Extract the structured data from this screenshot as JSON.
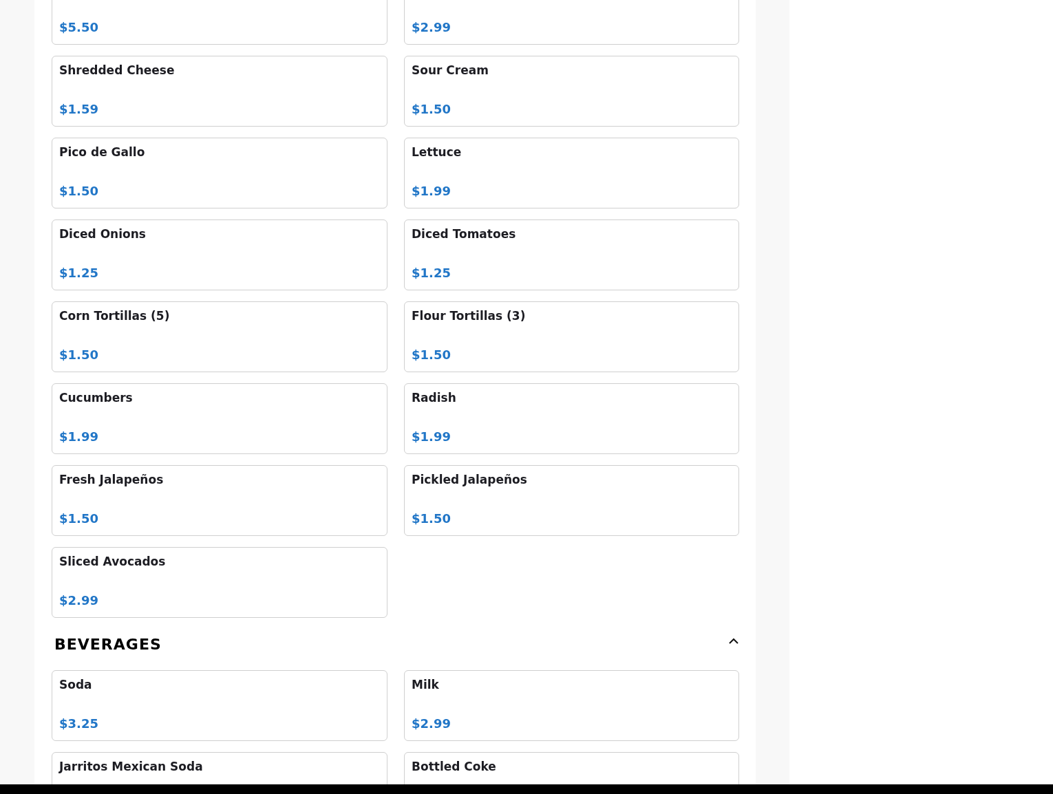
{
  "sections": [
    {
      "items": [
        {
          "price": "$5.50"
        },
        {
          "price": "$2.99"
        },
        {
          "name": "Shredded Cheese",
          "price": "$1.59"
        },
        {
          "name": "Sour Cream",
          "price": "$1.50"
        },
        {
          "name": "Pico de Gallo",
          "price": "$1.50"
        },
        {
          "name": "Lettuce",
          "price": "$1.99"
        },
        {
          "name": "Diced Onions",
          "price": "$1.25"
        },
        {
          "name": "Diced Tomatoes",
          "price": "$1.25"
        },
        {
          "name": "Corn Tortillas (5)",
          "price": "$1.50"
        },
        {
          "name": "Flour Tortillas (3)",
          "price": "$1.50"
        },
        {
          "name": "Cucumbers",
          "price": "$1.99"
        },
        {
          "name": "Radish",
          "price": "$1.99"
        },
        {
          "name": "Fresh Jalapeños",
          "price": "$1.50"
        },
        {
          "name": "Pickled Jalapeños",
          "price": "$1.50"
        },
        {
          "name": "Sliced Avocados",
          "price": "$2.99"
        }
      ]
    },
    {
      "title": "BEVERAGES",
      "expanded": true,
      "items": [
        {
          "name": "Soda",
          "price": "$3.25"
        },
        {
          "name": "Milk",
          "price": "$2.99"
        },
        {
          "name": "Jarritos Mexican Soda"
        },
        {
          "name": "Bottled Coke"
        }
      ]
    }
  ]
}
